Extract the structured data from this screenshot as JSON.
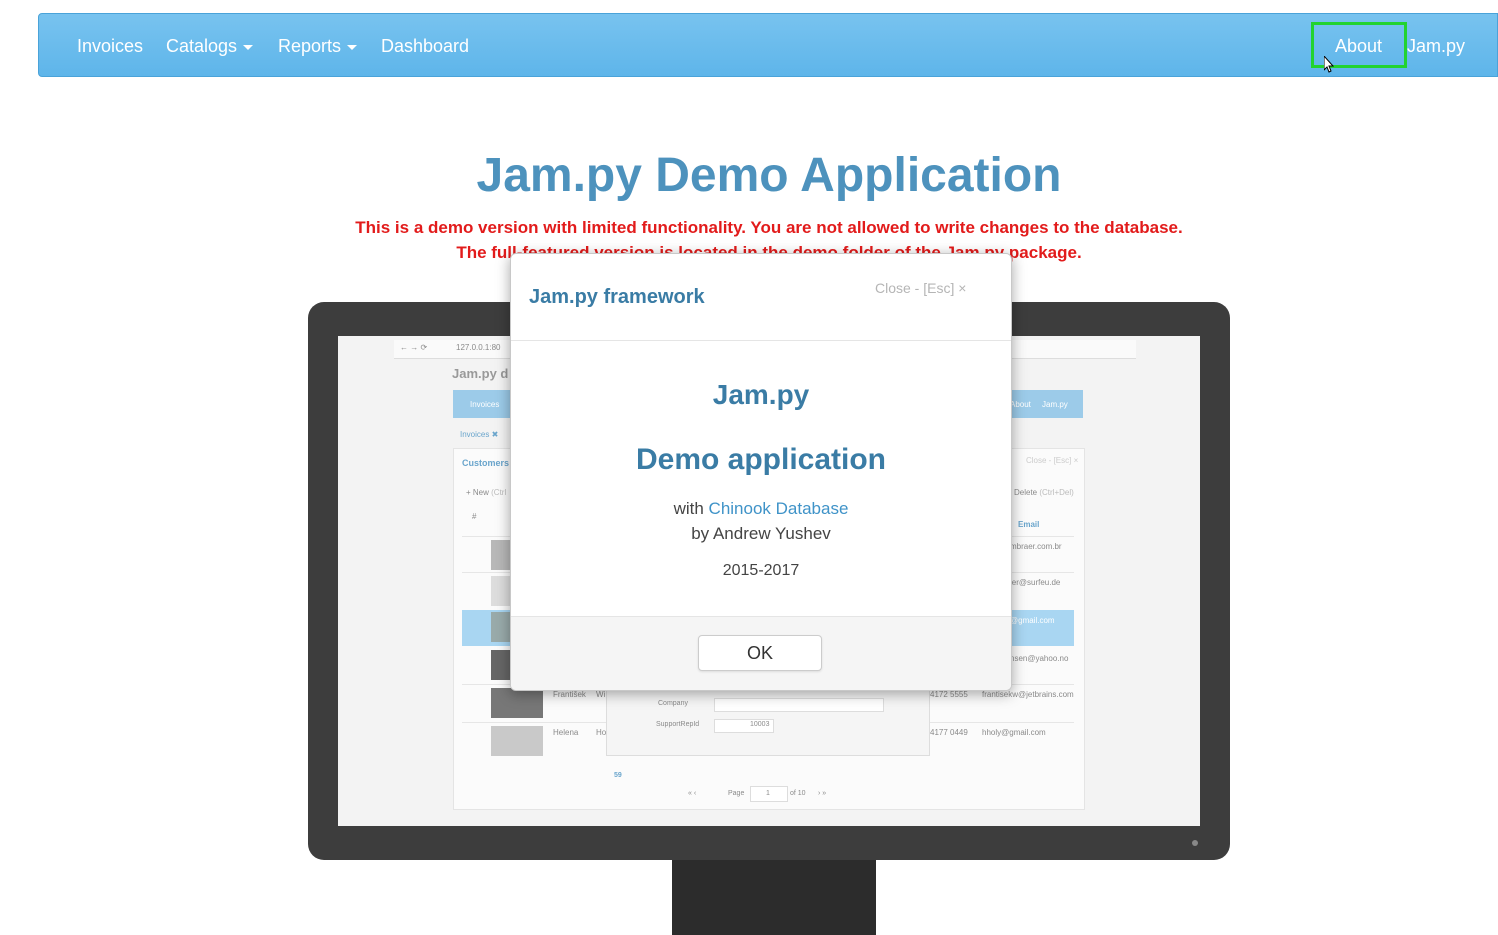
{
  "navbar": {
    "items": [
      {
        "label": "Invoices"
      },
      {
        "label": "Catalogs"
      },
      {
        "label": "Reports"
      },
      {
        "label": "Dashboard"
      }
    ],
    "right": [
      {
        "label": "About"
      },
      {
        "label": "Jam.py"
      }
    ]
  },
  "page": {
    "title": "Jam.py Demo Application",
    "warning_line1": "This is a demo version with limited functionality. You are not allowed to write changes to the database.",
    "warning_line2": "The full-featured version is located in the demo folder of the Jam.py package."
  },
  "modal": {
    "title": "Jam.py framework",
    "close_label": "Close - [Esc] ×",
    "heading": "Jam.py",
    "subheading": "Demo application",
    "with_prefix": "with",
    "with_link": "Chinook Database",
    "author": "by Andrew Yushev",
    "years": "2015-2017",
    "ok_label": "OK"
  },
  "screen_preview": {
    "url": "127.0.0.1:80",
    "app_title": "Jam.py d",
    "nav_left": "Invoices",
    "nav_about": "About",
    "nav_jampy": "Jam.py",
    "tab": "Invoices ✖",
    "section": "Customers",
    "new_button": "+ New",
    "new_shortcut": "(Ctrl",
    "delete_button": "Delete",
    "delete_shortcut": "(Ctrl+Del)",
    "dialog_close": "Close - [Esc] ×",
    "email_header": "Email",
    "hash_header": "#",
    "emails": [
      "mbraer.com.br",
      "ler@surfeu.de",
      "@gmail.com",
      "nsen@yahoo.no",
      "frantisekw@jetbrains.com",
      "hholy@gmail.com"
    ],
    "phones": [
      "4172 5555",
      "4177 0449"
    ],
    "names": [
      "František",
      "Helena"
    ],
    "name_suffixes": [
      "Wi",
      "Ho"
    ],
    "company_label": "Company",
    "support_label": "SupportRepId",
    "support_value": "10003",
    "total": "59",
    "page_label": "Page",
    "page_value": "1",
    "of_label": "of 10"
  }
}
